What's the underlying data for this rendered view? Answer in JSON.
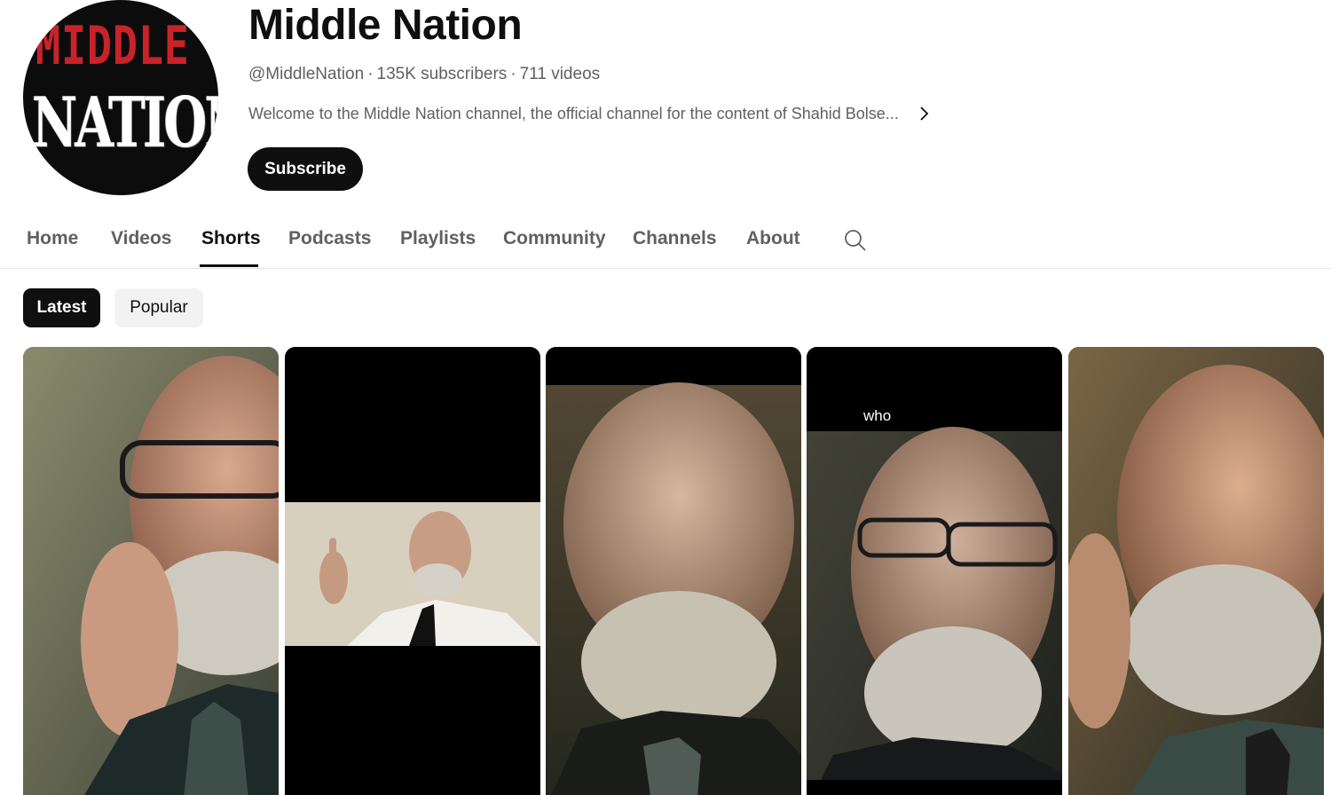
{
  "channel": {
    "name": "Middle Nation",
    "handle": "@MiddleNation",
    "subscribers": "135K subscribers",
    "videos": "711 videos",
    "description": "Welcome to the Middle Nation channel, the official channel for the content of Shahid Bolse...",
    "subscribe_label": "Subscribe",
    "avatar_logo": {
      "line1": "MIDDLE",
      "line2": "NATION"
    }
  },
  "tabs": [
    {
      "label": "Home",
      "active": false
    },
    {
      "label": "Videos",
      "active": false
    },
    {
      "label": "Shorts",
      "active": true
    },
    {
      "label": "Podcasts",
      "active": false
    },
    {
      "label": "Playlists",
      "active": false
    },
    {
      "label": "Community",
      "active": false
    },
    {
      "label": "Channels",
      "active": false
    },
    {
      "label": "About",
      "active": false
    }
  ],
  "search_icon": "search-icon",
  "filters": [
    {
      "label": "Latest",
      "selected": true
    },
    {
      "label": "Popular",
      "selected": false
    }
  ],
  "shorts": [
    {
      "thumb": "man-with-glasses-hand-on-chin",
      "overlay_text": ""
    },
    {
      "thumb": "man-pointing-finger-letterboxed",
      "overlay_text": ""
    },
    {
      "thumb": "man-speaking-closeup",
      "overlay_text": ""
    },
    {
      "thumb": "man-with-glasses-speaking",
      "overlay_text": "who"
    },
    {
      "thumb": "man-hand-on-cheek",
      "overlay_text": ""
    }
  ],
  "colors": {
    "text_primary": "#0f0f0f",
    "text_secondary": "#606060",
    "logo_red": "#c8232a",
    "chip_bg": "#f2f2f2",
    "divider": "#e5e5e5"
  }
}
